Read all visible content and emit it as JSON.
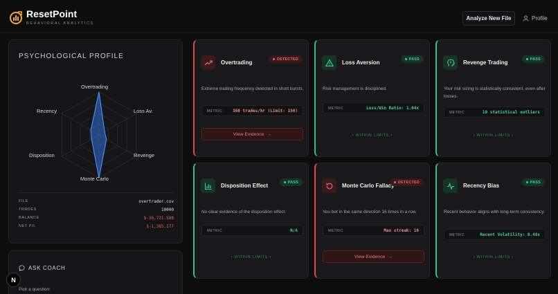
{
  "header": {
    "brand": "ResetPoint",
    "subtitle": "BEHAVIORAL ANALYTICS",
    "analyze_label": "Analyze New File",
    "profile_label": "Profile",
    "accent": "#f2a93b"
  },
  "profile": {
    "title": "PSYCHOLOGICAL PROFILE",
    "radar_axes": [
      "Overtrading",
      "Loss Av.",
      "Revenge",
      "Monte Carlo",
      "Disposition",
      "Recency"
    ],
    "radar_values": [
      1.0,
      0.15,
      0.2,
      1.0,
      0.2,
      0.22
    ],
    "file_label": "FILE",
    "file_value": "overtrader.csv",
    "trades_label": "TRADES",
    "trades_value": "10000",
    "balance_label": "BALANCE",
    "balance_value": "$-36,731.588",
    "netpl_label": "NET P/L",
    "netpl_value": "$-1,385.177"
  },
  "coach": {
    "title": "ASK COACH",
    "pick": "Pick a question:"
  },
  "common": {
    "metric_label": "METRIC",
    "within_limits": "• WITHIN LIMITS •",
    "view_evidence": "View Evidence",
    "arrow": "→"
  },
  "cards": [
    {
      "title": "Overtrading",
      "status": "DETECTED",
      "desc": "Extreme trading frequency detected in short bursts.",
      "metric": "360 trades/hr (Limit: 150)",
      "icon": "trend-up-icon"
    },
    {
      "title": "Loss Aversion",
      "status": "PASS",
      "desc": "Risk management is disciplined.",
      "metric": "Loss/Win Ratio: 1.04x",
      "icon": "warning-icon"
    },
    {
      "title": "Revenge Trading",
      "status": "PASS",
      "desc": "Your risk sizing is statistically consistent, even after losses.",
      "metric": "10 statistical outliers",
      "icon": "head-icon"
    },
    {
      "title": "Disposition Effect",
      "status": "PASS",
      "desc": "No clear evidence of the disposition effect.",
      "metric": "N/A",
      "icon": "bar-chart-icon"
    },
    {
      "title": "Monte Carlo Fallacy",
      "status": "DETECTED",
      "desc": "You bet in the same direction 16 times in a row.",
      "metric": "Max streak: 16",
      "icon": "rotate-icon"
    },
    {
      "title": "Recency Bias",
      "status": "PASS",
      "desc": "Recent behavior aligns with long-term consistency.",
      "metric": "Recent Volatility: 0.48x",
      "icon": "pulse-icon"
    }
  ],
  "colors": {
    "detected": "#e24848",
    "pass": "#2fc28a",
    "radar_fill": "#2f6fd8"
  }
}
